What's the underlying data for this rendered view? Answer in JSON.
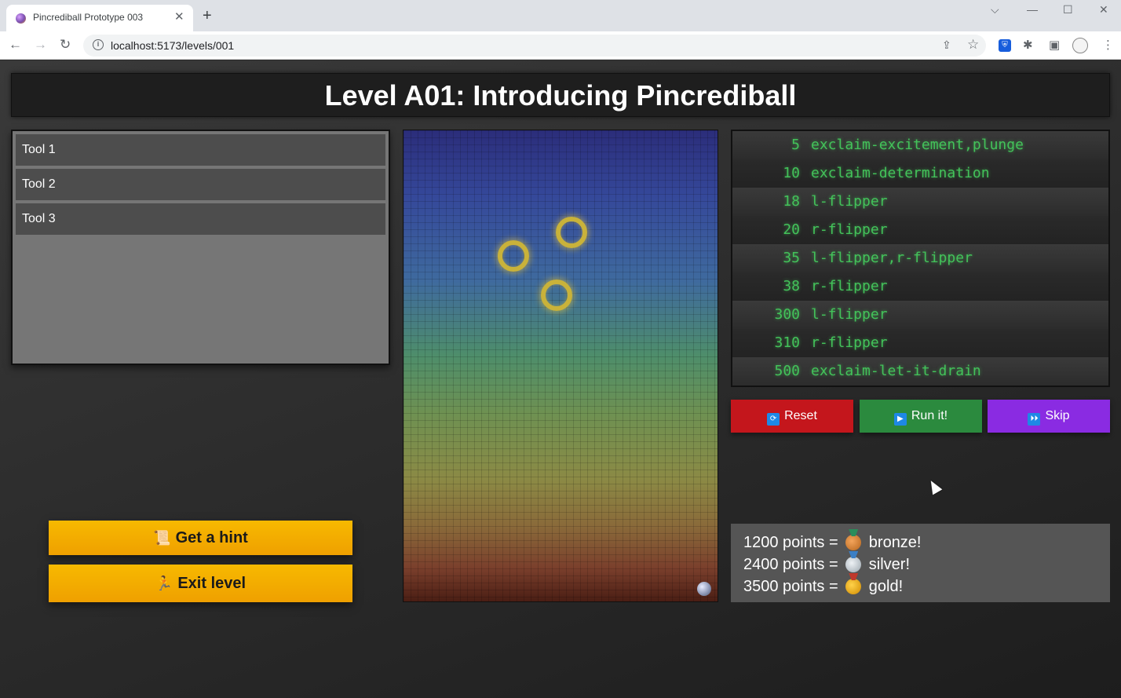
{
  "browser": {
    "tab_title": "Pincrediball Prototype 003",
    "tab_close": "✕",
    "new_tab": "+",
    "url": "localhost:5173/levels/001",
    "window_controls": {
      "dropdown": "⌵",
      "minimize": "—",
      "maximize": "☐",
      "close": "✕"
    },
    "nav": {
      "back": "←",
      "forward": "→",
      "reload": "↻"
    },
    "icons": [
      "info-icon",
      "share-icon",
      "star-icon",
      "bitwarden-icon",
      "extensions-icon",
      "sidepanel-icon",
      "profile-avatar",
      "menu-icon"
    ]
  },
  "level": {
    "title": "Level A01: Introducing Pincrediball"
  },
  "tools": {
    "items": [
      {
        "label": "Tool 1"
      },
      {
        "label": "Tool 2"
      },
      {
        "label": "Tool 3"
      }
    ]
  },
  "actions": {
    "hint_label": "Get a hint",
    "hint_icon": "📜",
    "exit_label": "Exit level",
    "exit_icon": "🏃"
  },
  "events": [
    {
      "time": "5",
      "name": "exclaim-excitement,plunge"
    },
    {
      "time": "10",
      "name": "exclaim-determination"
    },
    {
      "time": "18",
      "name": "l-flipper"
    },
    {
      "time": "20",
      "name": "r-flipper"
    },
    {
      "time": "35",
      "name": "l-flipper,r-flipper"
    },
    {
      "time": "38",
      "name": "r-flipper"
    },
    {
      "time": "300",
      "name": "l-flipper"
    },
    {
      "time": "310",
      "name": "r-flipper"
    },
    {
      "time": "500",
      "name": "exclaim-let-it-drain"
    }
  ],
  "controls": {
    "reset_label": "Reset",
    "reset_icon": "🔄",
    "run_label": "Run it!",
    "run_icon": "▶",
    "skip_label": "Skip",
    "skip_icon": "⏩"
  },
  "medals": [
    {
      "points_text": "1200 points =",
      "label": "bronze!",
      "medal": "bronze"
    },
    {
      "points_text": "2400 points =",
      "label": "silver!",
      "medal": "silver"
    },
    {
      "points_text": "3500 points =",
      "label": "gold!",
      "medal": "gold"
    }
  ],
  "colors": {
    "reset": "#c4161c",
    "run": "#2b8a3e",
    "skip": "#8a2be2",
    "hint_button": "#f5b000",
    "event_text": "#43c25a"
  }
}
